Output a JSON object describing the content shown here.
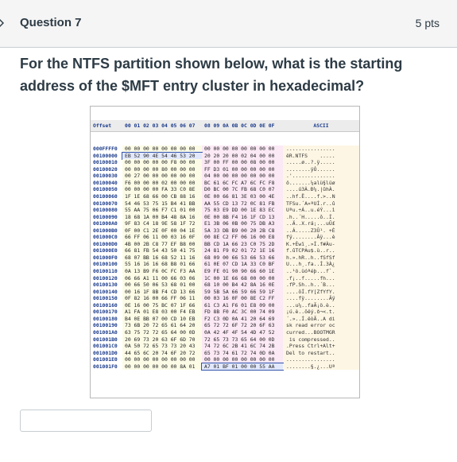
{
  "question": {
    "title": "Question 7",
    "points": "5 pts",
    "text": "For the NTFS partition shown below, what is the starting address of the $MFT entry cluster in hexadecimal?"
  },
  "hexdump": {
    "headers": {
      "offset": "Offset",
      "groupA": "00 01 02 03 04 05 06 07",
      "groupB": "08 09 0A 0B 0C 0D 0E 0F",
      "ascii": "ASCII"
    },
    "rows": [
      {
        "off": "000FFFF0",
        "a": "00 00 00 00 00 00 00 00",
        "b": "00 00 00 00 00 00 00 00",
        "t": "................"
      },
      {
        "off": "00100000",
        "a": "EB 52 90 4E 54 46 53 20",
        "b": "20 20 20 00 02 04 00 00",
        "t": "ëR.NTFS    ....."
      },
      {
        "off": "00100010",
        "a": "00 00 00 00 00 F8 00 00",
        "b": "3F 00 FF 00 00 08 00 00",
        "t": ".....ø..?.ÿ....."
      },
      {
        "off": "00100020",
        "a": "00 00 00 00 80 00 00 00",
        "b": "FF D3 01 00 00 00 00 00",
        "t": "........ÿÓ......"
      },
      {
        "off": "00100030",
        "a": "00 27 00 00 00 00 00 00",
        "b": "04 00 00 00 00 00 00 00",
        "t": ".'.............."
      },
      {
        "off": "00100040",
        "a": "F6 00 00 00 02 00 00 00",
        "b": "BC 61 6C FC A7 6C FC F8",
        "t": "ö.......¼alü§lüø"
      },
      {
        "off": "00100050",
        "a": "00 00 00 00 FA 33 C0 8E",
        "b": "D0 BC 00 7C FB 68 C0 07",
        "t": "....ú3À.Ð¼.|ûhÀ."
      },
      {
        "off": "00100060",
        "a": "1F 1E 68 66 00 CB 88 16",
        "b": "0E 00 66 81 3E 03 00 4E",
        "t": "..hf.Ë....f.>..N"
      },
      {
        "off": "00100070",
        "a": "54 46 53 75 15 B4 41 BB",
        "b": "AA 55 CD 13 72 0C 81 FB",
        "t": "TFSu.´A»ªUÍ.r..û"
      },
      {
        "off": "00100080",
        "a": "55 AA 75 06 F7 C1 01 00",
        "b": "75 03 E9 DD 00 1E 83 EC",
        "t": "Uªu.÷Á..u.éÝ...ì"
      },
      {
        "off": "00100090",
        "a": "18 68 1A 00 B4 48 8A 16",
        "b": "0E 00 8B F4 16 1F CD 13",
        "t": ".h..´H.....ô..Í."
      },
      {
        "off": "001000A0",
        "a": "9F 83 C4 18 9E 58 1F 72",
        "b": "E1 3B 06 0B 00 75 DB A3",
        "t": "..Ä..X.rá;...uÛ£"
      },
      {
        "off": "001000B0",
        "a": "0F 00 C1 2E 0F 00 04 1E",
        "b": "5A 33 DB B9 00 20 2B C8",
        "t": "..Á.....Z3Û¹. +È"
      },
      {
        "off": "001000C0",
        "a": "66 FF 06 11 00 03 16 0F",
        "b": "00 8E C2 FF 06 16 00 E8",
        "t": "fÿ........Âÿ...è"
      },
      {
        "off": "001000D0",
        "a": "4B 00 2B C8 77 EF B8 00",
        "b": "BB CD 1A 66 23 C0 75 2D",
        "t": "K.+Èwï¸.»Í.f#Àu-"
      },
      {
        "off": "001000E0",
        "a": "66 81 FB 54 43 50 41 75",
        "b": "24 81 F9 02 01 72 1E 16",
        "t": "f.ûTCPAu$.ù..r.."
      },
      {
        "off": "001000F0",
        "a": "68 07 BB 16 68 52 11 16",
        "b": "68 09 00 66 53 66 53 66",
        "t": "h.».hR..h..fSfSf"
      },
      {
        "off": "00100100",
        "a": "55 16 16 16 68 B8 01 66",
        "b": "61 0E 07 CD 1A 33 C0 BF",
        "t": "U...h¸.fa..Í.3À¿"
      },
      {
        "off": "00100110",
        "a": "0A 13 B9 F6 0C FC F3 AA",
        "b": "E9 FE 01 90 90 66 60 1E",
        "t": "..¹ö.üóªéþ...f`."
      },
      {
        "off": "00100120",
        "a": "06 66 A1 11 00 66 03 06",
        "b": "1C 00 1E 66 68 00 00 00",
        "t": ".f¡..f.....fh..."
      },
      {
        "off": "00100130",
        "a": "00 66 50 06 53 68 01 00",
        "b": "68 10 00 B4 42 8A 16 0E",
        "t": ".fP.Sh..h..´B..."
      },
      {
        "off": "00100140",
        "a": "00 16 1F 8B F4 CD 13 66",
        "b": "59 5B 5A 66 59 66 59 1F",
        "t": "....ôÍ.fY[ZfYfY."
      },
      {
        "off": "00100150",
        "a": "0F 82 16 00 66 FF 06 11",
        "b": "00 03 16 0F 00 8E C2 FF",
        "t": "....fÿ........Âÿ"
      },
      {
        "off": "00100160",
        "a": "0E 16 00 75 BC 07 1F 66",
        "b": "61 C3 A1 F6 01 E8 09 00",
        "t": "...u¼..faÃ¡ö.è.."
      },
      {
        "off": "00100170",
        "a": "A1 FA 01 E8 03 00 F4 EB",
        "b": "FD 8B F0 AC 3C 00 74 09",
        "t": "¡ú.è..ôëý.ð¬<.t."
      },
      {
        "off": "00100180",
        "a": "B4 0E BB 07 00 CD 10 EB",
        "b": "F2 C3 0D 0A 41 20 64 69",
        "t": "´.»..Í.ëòÃ..A di"
      },
      {
        "off": "00100190",
        "a": "73 6B 20 72 65 61 64 20",
        "b": "65 72 72 6F 72 20 6F 63",
        "t": "sk read error oc"
      },
      {
        "off": "001001A0",
        "a": "63 75 72 72 65 64 00 0D",
        "b": "0A 42 4F 4F 54 4D 47 52",
        "t": "curred...BOOTMGR"
      },
      {
        "off": "001001B0",
        "a": "20 69 73 20 63 6F 6D 70",
        "b": "72 65 73 73 65 64 00 0D",
        "t": " is compressed.."
      },
      {
        "off": "001001C0",
        "a": "0A 50 72 65 73 73 20 43",
        "b": "74 72 6C 2B 41 6C 74 2B",
        "t": ".Press Ctrl+Alt+"
      },
      {
        "off": "001001D0",
        "a": "44 65 6C 20 74 6F 20 72",
        "b": "65 73 74 61 72 74 0D 0A",
        "t": "Del to restart.."
      },
      {
        "off": "001001E0",
        "a": "00 00 00 00 00 00 00 00",
        "b": "00 00 00 00 00 00 00 00",
        "t": "................"
      },
      {
        "off": "001001F0",
        "a": "00 00 00 00 00 00 8A 01",
        "b": "A7 01 BF 01 00 00 55 AA",
        "t": "........§.¿...Uª"
      }
    ]
  },
  "answer": {
    "value": ""
  }
}
